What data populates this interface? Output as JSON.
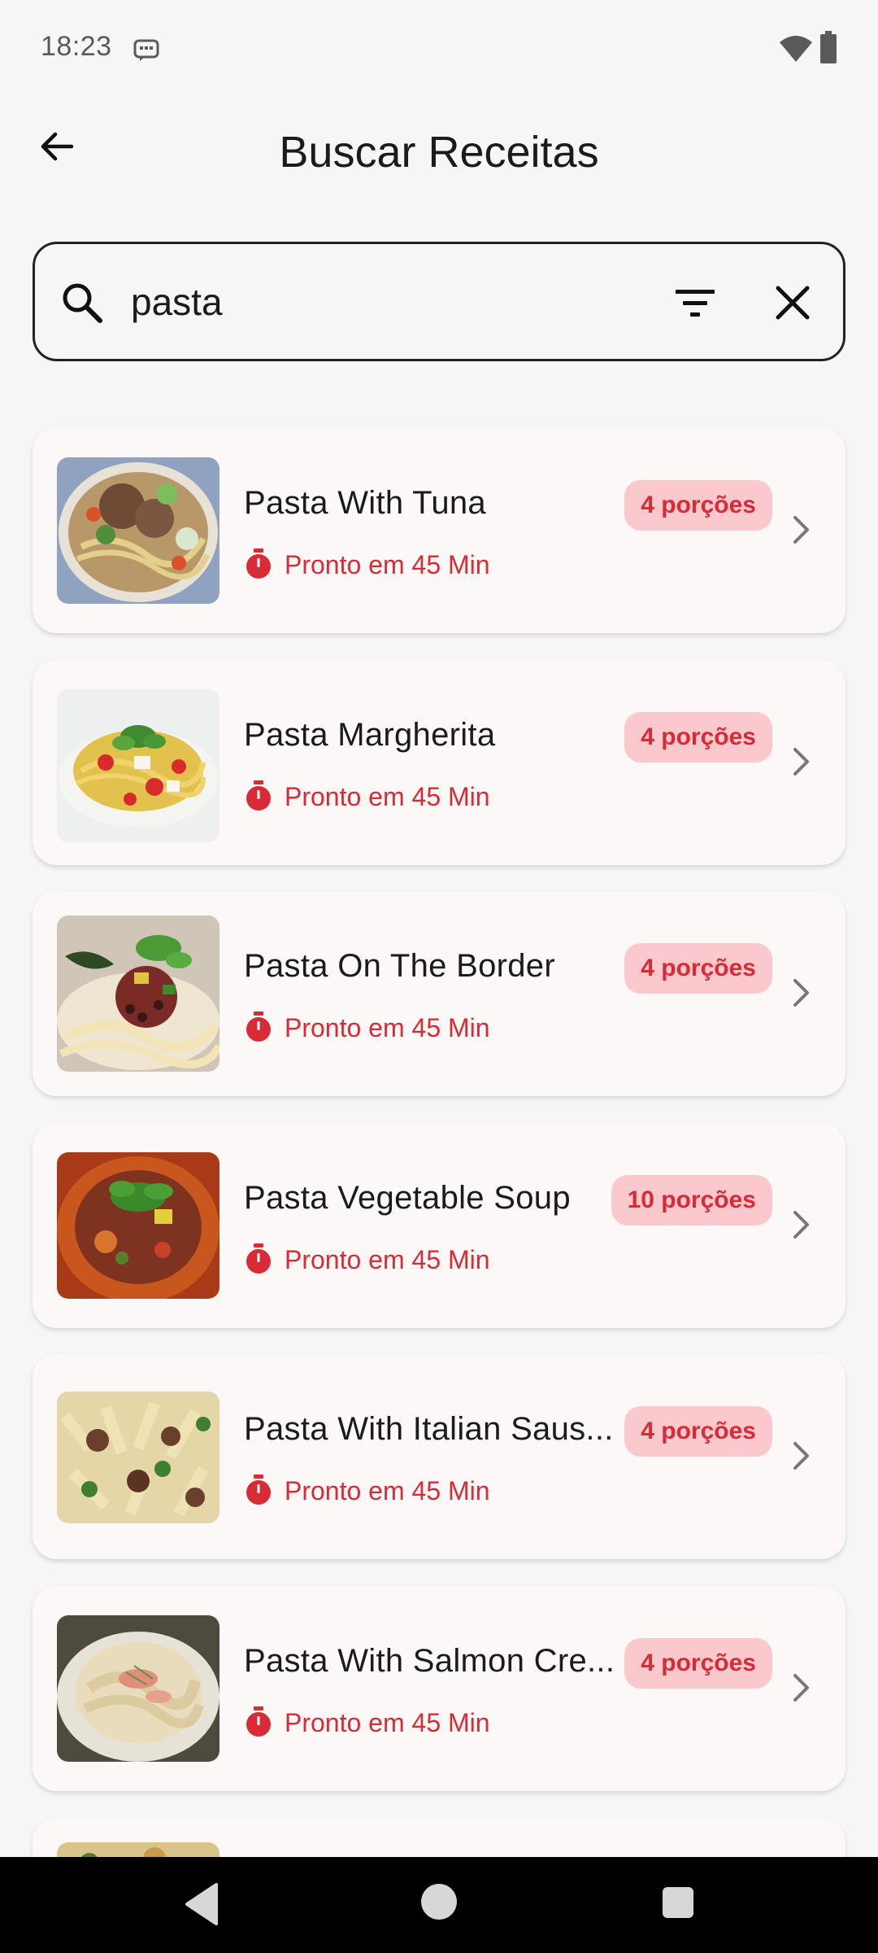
{
  "status_bar": {
    "time": "18:23",
    "icons": [
      "message-icon",
      "wifi-icon",
      "battery-icon"
    ]
  },
  "header": {
    "title": "Buscar Receitas",
    "back_icon": "arrow-left-icon"
  },
  "search": {
    "value": "pasta",
    "icons": [
      "search-icon",
      "filter-icon",
      "close-icon"
    ]
  },
  "recipes": [
    {
      "name": "Pasta With Tuna",
      "servings": "4 porções",
      "ready": "Pronto em 45 Min"
    },
    {
      "name": "Pasta Margherita",
      "servings": "4 porções",
      "ready": "Pronto em 45 Min"
    },
    {
      "name": "Pasta On The Border",
      "servings": "4 porções",
      "ready": "Pronto em 45 Min"
    },
    {
      "name": "Pasta Vegetable Soup",
      "servings": "10 porções",
      "ready": "Pronto em 45 Min"
    },
    {
      "name": "Pasta With Italian Saus...",
      "servings": "4 porções",
      "ready": "Pronto em 45 Min"
    },
    {
      "name": "Pasta With Salmon Cre...",
      "servings": "4 porções",
      "ready": "Pronto em 45 Min"
    }
  ],
  "colors": {
    "accent": "#d92b35",
    "badge_bg": "#fbc9cd",
    "card_bg": "#fdf8f8",
    "page_bg": "#f7f6f6"
  }
}
